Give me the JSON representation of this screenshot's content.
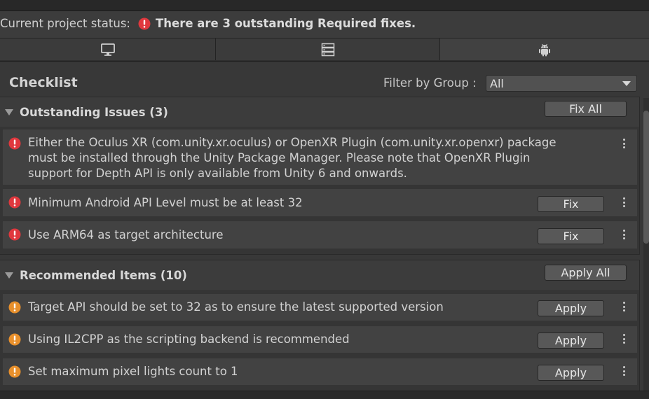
{
  "status": {
    "label": "Current project status:",
    "message": "There are 3 outstanding Required fixes."
  },
  "tabs": [
    {
      "icon": "monitor-icon",
      "active": false
    },
    {
      "icon": "server-icon",
      "active": false
    },
    {
      "icon": "android-icon",
      "active": true
    }
  ],
  "checklist": {
    "title": "Checklist",
    "filter_label": "Filter by Group :",
    "filter_value": "All"
  },
  "outstanding": {
    "title": "Outstanding Issues (3)",
    "action_label": "Fix All",
    "items": [
      {
        "text": "Either the Oculus XR (com.unity.xr.oculus) or OpenXR Plugin (com.unity.xr.openxr) package\nmust be installed through the Unity Package Manager. Please note that OpenXR Plugin\nsupport for Depth API is only available from Unity 6 and onwards.",
        "button": null,
        "severity": "error"
      },
      {
        "text": "Minimum Android API Level must be at least 32",
        "button": "Fix",
        "severity": "error"
      },
      {
        "text": "Use ARM64 as target architecture",
        "button": "Fix",
        "severity": "error"
      }
    ]
  },
  "recommended": {
    "title": "Recommended Items (10)",
    "action_label": "Apply All",
    "items": [
      {
        "text": "Target API should be set to 32 as to ensure the latest supported version",
        "button": "Apply",
        "severity": "warning"
      },
      {
        "text": "Using IL2CPP as the scripting backend is recommended",
        "button": "Apply",
        "severity": "warning"
      },
      {
        "text": "Set maximum pixel lights count to 1",
        "button": "Apply",
        "severity": "warning"
      }
    ]
  },
  "colors": {
    "error": "#e0383e",
    "warning": "#e8902c",
    "panel": "#383838"
  }
}
